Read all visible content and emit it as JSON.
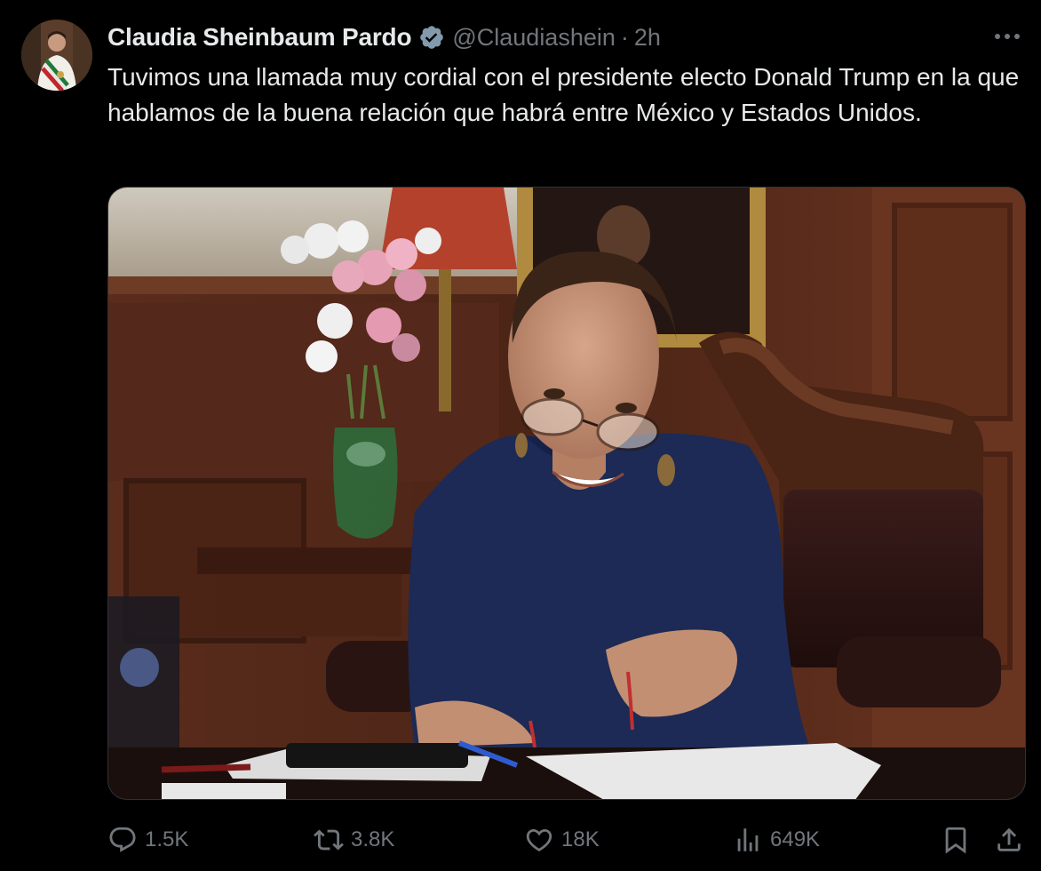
{
  "author": {
    "display_name": "Claudia Sheinbaum Pardo",
    "handle": "@Claudiashein",
    "separator": "·",
    "time": "2h",
    "verified": true
  },
  "tweet": {
    "text": "Tuvimos una llamada muy cordial con el presidente electo Donald Trump en la que hablamos de la buena relación que habrá entre México y Estados Unidos."
  },
  "more_label": "•••",
  "actions": {
    "reply_count": "1.5K",
    "retweet_count": "3.8K",
    "like_count": "18K",
    "views_count": "649K"
  },
  "colors": {
    "background": "#000000",
    "text_primary": "#e7e9ea",
    "text_secondary": "#71767b",
    "verified_badge": "#829aab"
  },
  "icons": {
    "reply": "reply-icon",
    "retweet": "retweet-icon",
    "like": "like-icon",
    "views": "views-icon",
    "bookmark": "bookmark-icon",
    "share": "share-icon",
    "more": "more-icon",
    "verified": "verified-badge-icon"
  }
}
